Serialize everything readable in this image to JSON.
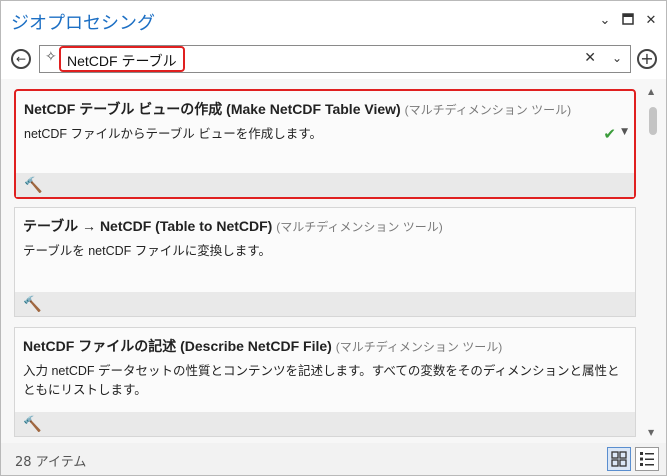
{
  "pane": {
    "title": "ジオプロセシング"
  },
  "search": {
    "value": "NetCDF テーブル"
  },
  "results": [
    {
      "name": "NetCDF テーブル ビューの作成 (Make NetCDF Table View)",
      "type": "(マルチディメンション ツール)",
      "description": "netCDF ファイルからテーブル ビューを作成します。"
    },
    {
      "name": "テーブル → NetCDF (Table to NetCDF)",
      "type": "(マルチディメンション ツール)",
      "description": "テーブルを netCDF ファイルに変換します。"
    },
    {
      "name": "NetCDF ファイルの記述 (Describe NetCDF File)",
      "type": "(マルチディメンション ツール)",
      "description": "入力 netCDF データセットの性質とコンテンツを記述します。すべての変数をそのディメンションと属性とともにリストします。"
    }
  ],
  "status": {
    "count": "28 アイテム"
  },
  "colors": {
    "accent": "#1c6fc4",
    "highlight": "#e02020",
    "check": "#3a9c3a"
  }
}
